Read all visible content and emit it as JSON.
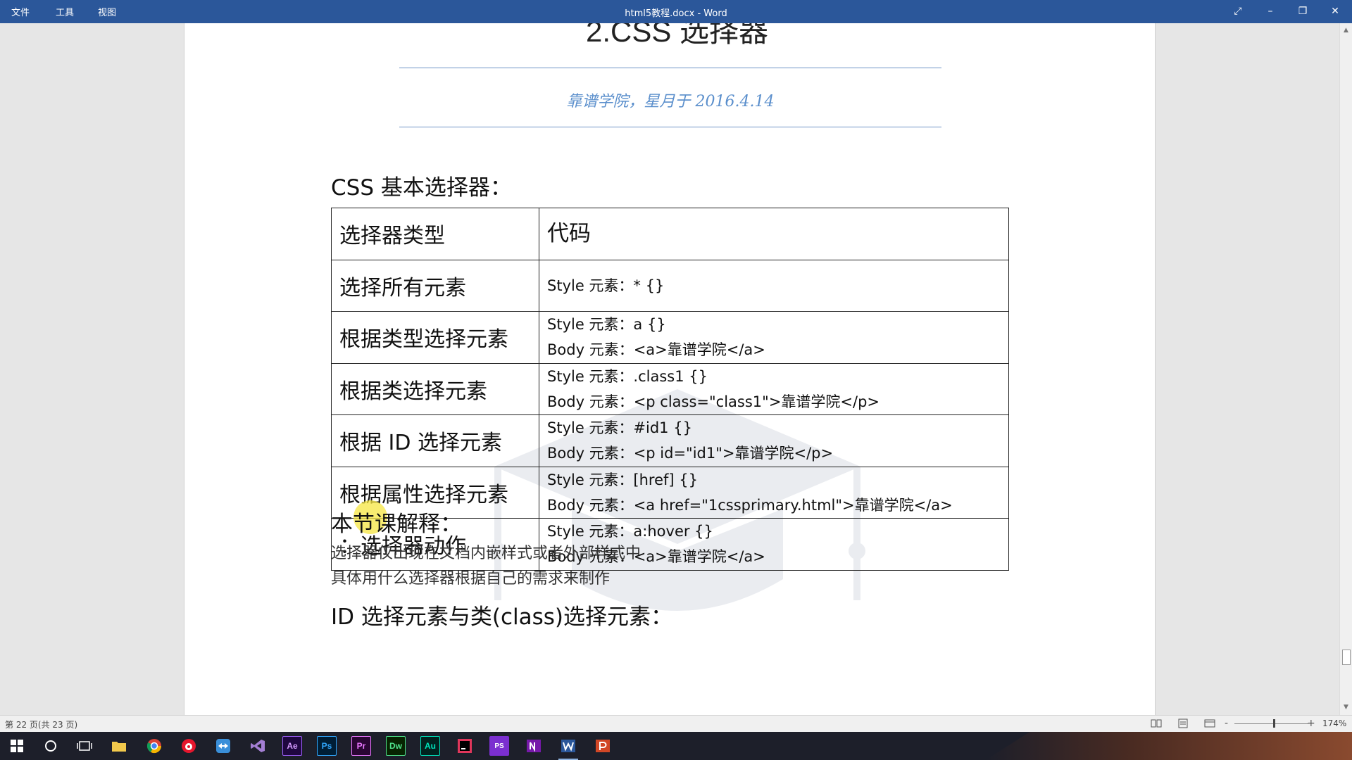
{
  "titlebar": {
    "menu": [
      "文件",
      "工具",
      "视图"
    ],
    "title": "html5教程.docx - Word"
  },
  "document": {
    "heading_fragment": "2.CSS 选择器",
    "subtitle": "靠谱学院，星月于 2016.4.14",
    "section1_heading": "CSS 基本选择器：",
    "table": {
      "header": [
        "选择器类型",
        "代码"
      ],
      "rows": [
        {
          "type": "选择所有元素",
          "lines": [
            "Style 元素：* {}"
          ]
        },
        {
          "type": "根据类型选择元素",
          "lines": [
            "Style 元素：a {}",
            "Body 元素：<a>靠谱学院</a>"
          ]
        },
        {
          "type": "根据类选择元素",
          "lines": [
            "Style 元素：.class1 {}",
            "Body 元素：<p class=\"class1\">靠谱学院</p>"
          ]
        },
        {
          "type": "根据 ID 选择元素",
          "lines": [
            "Style 元素：#id1 {}",
            "Body 元素：<p id=\"id1\">靠谱学院</p>"
          ]
        },
        {
          "type": "根据属性选择元素",
          "lines": [
            "Style 元素：[href] {}",
            "Body 元素：<a href=\"1cssprimary.html\">靠谱学院</a>"
          ]
        },
        {
          "type": "：选择器动作",
          "lines": [
            "Style 元素：a:hover {}",
            "Body 元素：<a>靠谱学院</a>"
          ]
        }
      ]
    },
    "section2_heading": "本节课解释：",
    "explanation": [
      "选择器仅出现在文档内嵌样式或者外部样式中",
      "具体用什么选择器根据自己的需求来制作"
    ],
    "section3_heading": "ID 选择元素与类(class)选择元素："
  },
  "statusbar": {
    "page_info": "第 22 页(共 23 页)",
    "zoom": "174%",
    "zoom_minus": "-",
    "zoom_plus": "+"
  },
  "taskbar": {
    "apps": [
      "Ae",
      "Ps",
      "Pr",
      "Dw",
      "Au",
      "PS"
    ]
  },
  "colors": {
    "titlebar": "#2b579a",
    "accent_rule": "#6f94c6",
    "subtitle": "#5b8fcc"
  }
}
